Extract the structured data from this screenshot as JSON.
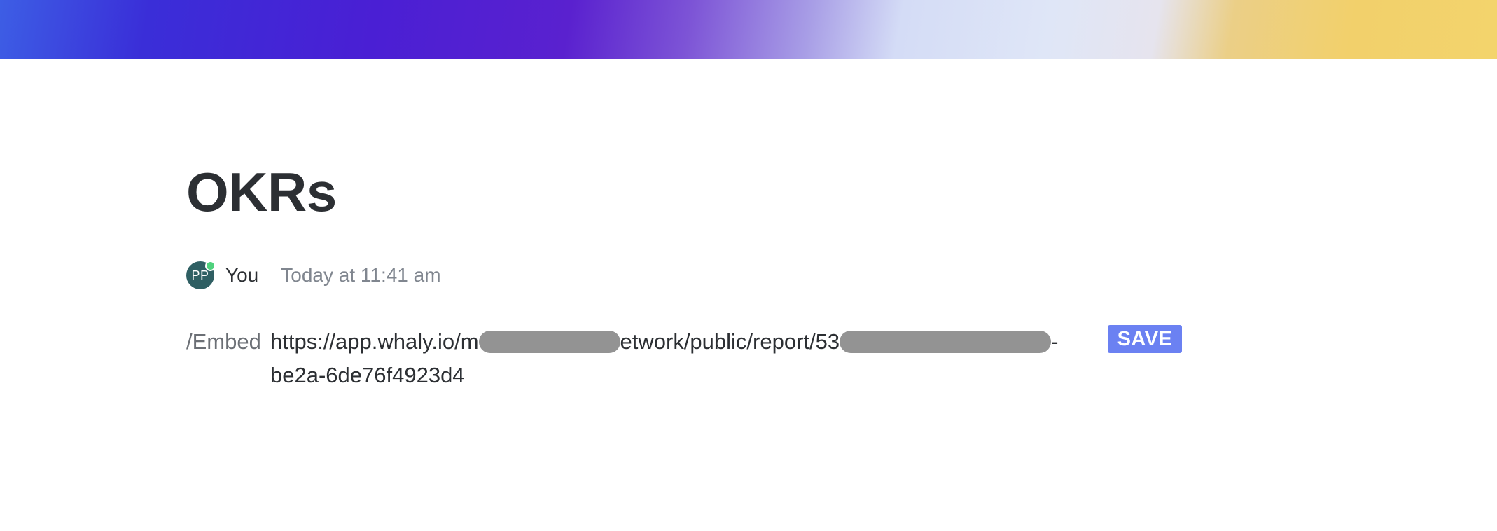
{
  "cover": {
    "colors": [
      "#3d5ee5",
      "#4a1fd4",
      "#dfe6f7",
      "#f3d46c"
    ]
  },
  "page": {
    "title": "OKRs"
  },
  "meta": {
    "avatar_initials": "PP",
    "avatar_color": "#2f5f63",
    "online_indicator_color": "#4fd17d",
    "author": "You",
    "timestamp": "Today at 11:41 am"
  },
  "embed": {
    "command": "/Embed",
    "url_part_1": "https://app.whaly.io/m",
    "url_part_2": "etwork/public/report/53",
    "url_part_3": "-",
    "url_line_2": "be2a-6de76f4923d4",
    "save_label": "SAVE",
    "save_color": "#6b81f2"
  }
}
